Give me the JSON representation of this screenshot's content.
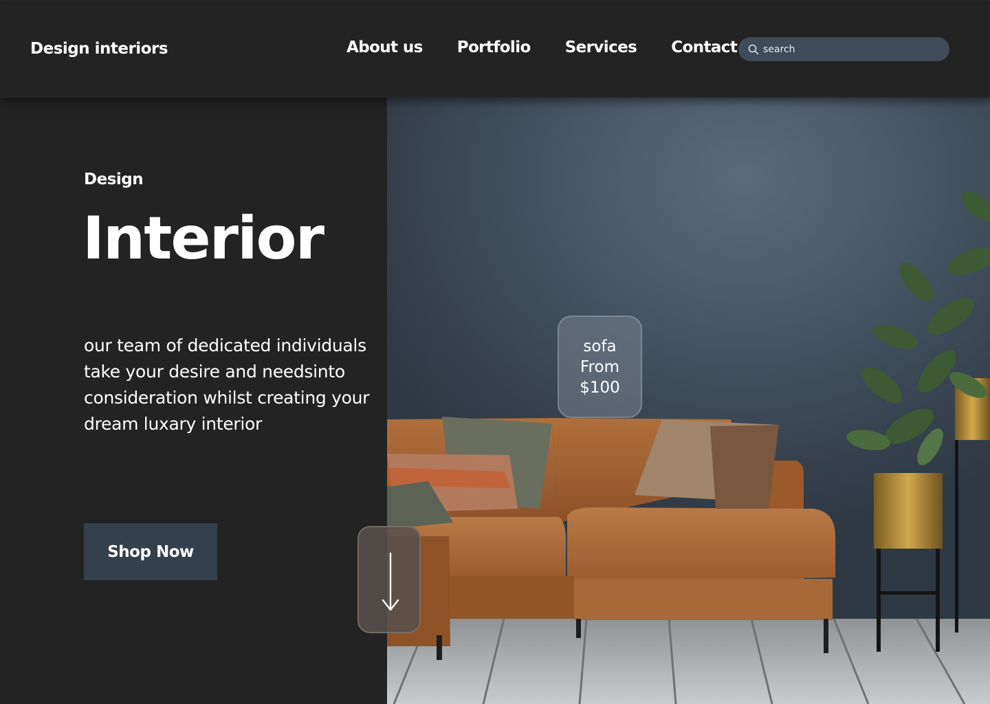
{
  "header": {
    "brand": "Design interiors",
    "nav": [
      {
        "label": "About us"
      },
      {
        "label": "Portfolio"
      },
      {
        "label": "Services"
      },
      {
        "label": "Contact"
      }
    ],
    "search": {
      "placeholder": "search",
      "icon": "search-icon"
    }
  },
  "hero": {
    "eyebrow": "Design",
    "title": "Interior",
    "copy": "our team of dedicated individuals take your desire and needsinto consideration whilst creating your dream luxary interior",
    "cta_label": "Shop Now",
    "image": "living-room-photo"
  },
  "price_tag": {
    "line1": "sofa",
    "line2": "From",
    "line3": "$100"
  },
  "scroll": {
    "icon": "arrow-down-icon"
  },
  "colors": {
    "background": "#232323",
    "accent": "#34404c",
    "search_bg": "#3f4b58",
    "wall": "#465463",
    "sofa": "#a8683a"
  }
}
